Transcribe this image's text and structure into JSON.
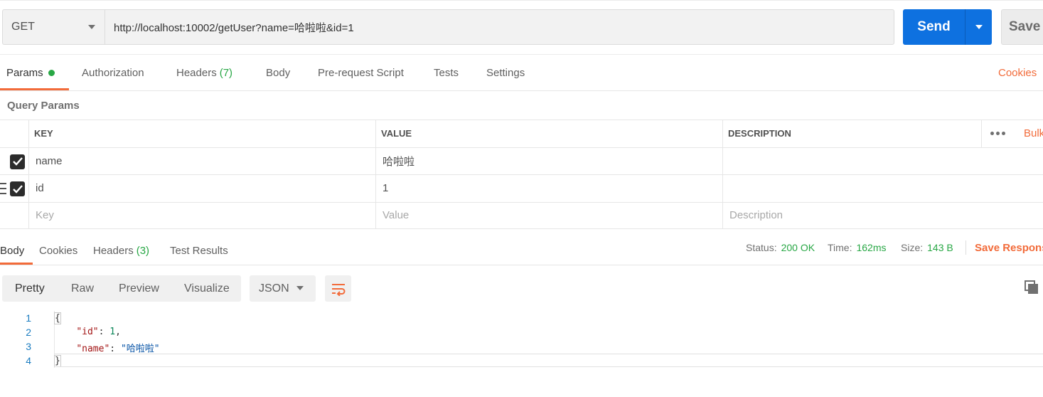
{
  "request": {
    "method": "GET",
    "url": "http://localhost:10002/getUser?name=哈啦啦&id=1",
    "send_label": "Send",
    "save_label": "Save"
  },
  "request_tabs": {
    "params": "Params",
    "authorization": "Authorization",
    "headers": "Headers",
    "headers_count": "(7)",
    "body": "Body",
    "pre_request": "Pre-request Script",
    "tests": "Tests",
    "settings": "Settings",
    "cookies": "Cookies"
  },
  "query_params": {
    "title": "Query Params",
    "columns": {
      "key": "KEY",
      "value": "VALUE",
      "description": "DESCRIPTION",
      "bulk": "Bulk"
    },
    "rows": [
      {
        "key": "name",
        "value": "哈啦啦",
        "description": "",
        "checked": true
      },
      {
        "key": "id",
        "value": "1",
        "description": "",
        "checked": true
      }
    ],
    "placeholders": {
      "key": "Key",
      "value": "Value",
      "description": "Description"
    }
  },
  "response_tabs": {
    "body": "Body",
    "cookies": "Cookies",
    "headers": "Headers",
    "headers_count": "(3)",
    "test_results": "Test Results"
  },
  "response_status": {
    "status_label": "Status:",
    "status_value": "200 OK",
    "time_label": "Time:",
    "time_value": "162ms",
    "size_label": "Size:",
    "size_value": "143 B",
    "save_response": "Save Respons"
  },
  "body_toolbar": {
    "pretty": "Pretty",
    "raw": "Raw",
    "preview": "Preview",
    "visualize": "Visualize",
    "language": "JSON"
  },
  "code": {
    "line_numbers": [
      "1",
      "2",
      "3",
      "4"
    ],
    "open": "{",
    "close": "}",
    "id_key": "\"id\"",
    "id_value": "1",
    "name_key": "\"name\"",
    "name_value": "\"哈啦啦\""
  },
  "colors": {
    "accent": "#f26b3a",
    "send": "#0e71e0",
    "success": "#28a745"
  }
}
